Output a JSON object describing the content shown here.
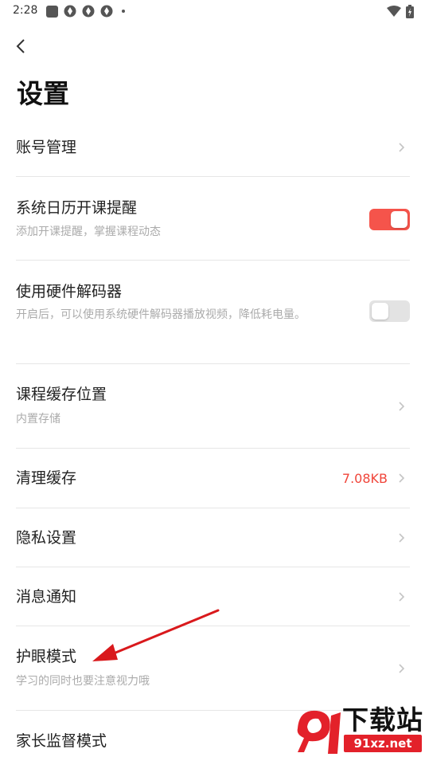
{
  "status_bar": {
    "time": "2:28"
  },
  "header": {
    "title": "设置"
  },
  "settings": {
    "account": {
      "title": "账号管理"
    },
    "calendar": {
      "title": "系统日历开课提醒",
      "subtitle": "添加开课提醒，掌握课程动态",
      "enabled": true
    },
    "decoder": {
      "title": "使用硬件解码器",
      "subtitle": "开启后，可以使用系统硬件解码器播放视频，降低耗电量。",
      "enabled": false
    },
    "cache_location": {
      "title": "课程缓存位置",
      "subtitle": "内置存储"
    },
    "clear_cache": {
      "title": "清理缓存",
      "value": "7.08KB"
    },
    "privacy": {
      "title": "隐私设置"
    },
    "notifications": {
      "title": "消息通知"
    },
    "eye_care": {
      "title": "护眼模式",
      "subtitle": "学习的同时也要注意视力哦"
    },
    "parental": {
      "title": "家长监督模式"
    }
  },
  "watermark": {
    "brand": "下载站",
    "url": "91xz.net"
  },
  "colors": {
    "accent": "#f5544b",
    "value_red": "#f0453a",
    "annotation_arrow": "#d9191c"
  },
  "icons": {
    "back": "chevron-left-icon",
    "row_arrow": "chevron-right-icon"
  }
}
